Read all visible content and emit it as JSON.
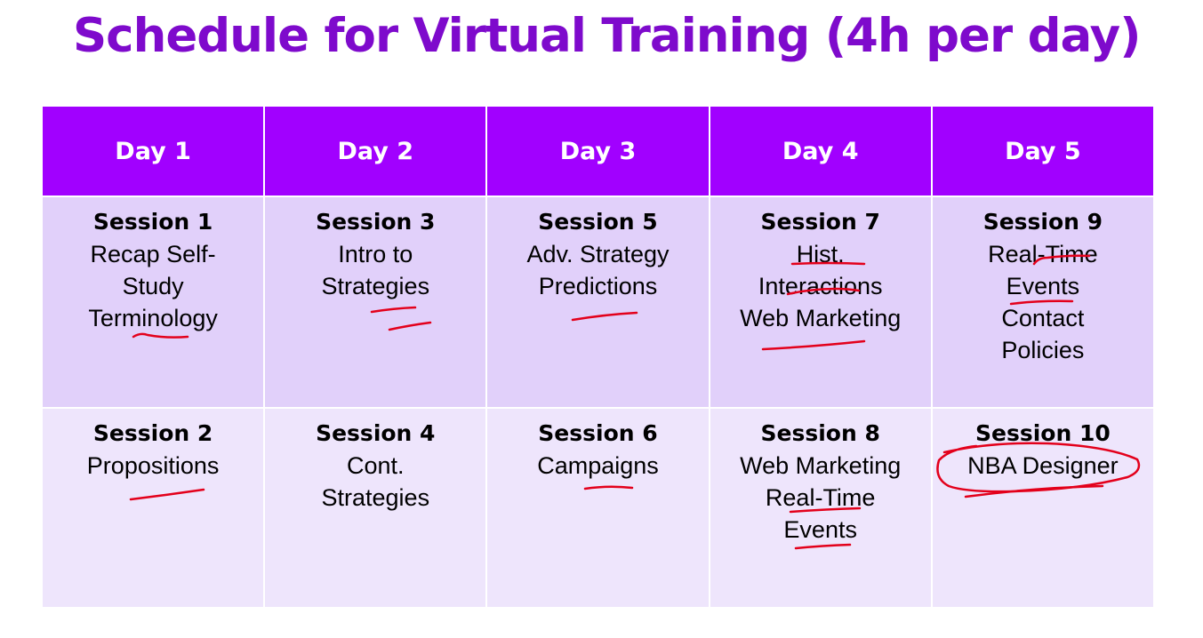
{
  "title": "Schedule for Virtual Training (4h per day)",
  "colors": {
    "title": "#7E0ACC",
    "header_bg": "#A100FF",
    "row1_bg": "#E1D0FA",
    "row2_bg": "#EEE5FC",
    "annotation": "#E3001B"
  },
  "days": [
    {
      "label": "Day 1",
      "sessions": [
        {
          "title": "Session 1",
          "topic": "Recap Self-\nStudy\nTerminology"
        },
        {
          "title": "Session 2",
          "topic": "Propositions"
        }
      ]
    },
    {
      "label": "Day 2",
      "sessions": [
        {
          "title": "Session 3",
          "topic": "Intro to\nStrategies"
        },
        {
          "title": "Session 4",
          "topic": "Cont.\nStrategies"
        }
      ]
    },
    {
      "label": "Day 3",
      "sessions": [
        {
          "title": "Session 5",
          "topic": "Adv. Strategy\nPredictions"
        },
        {
          "title": "Session 6",
          "topic": "Campaigns"
        }
      ]
    },
    {
      "label": "Day 4",
      "sessions": [
        {
          "title": "Session 7",
          "topic": "Hist.\nInteractions\nWeb Marketing"
        },
        {
          "title": "Session 8",
          "topic": "Web Marketing\nReal-Time\nEvents"
        }
      ]
    },
    {
      "label": "Day 5",
      "sessions": [
        {
          "title": "Session 9",
          "topic": "Real-Time\nEvents\nContact\nPolicies"
        },
        {
          "title": "Session 10",
          "topic": "NBA Designer"
        }
      ]
    }
  ]
}
